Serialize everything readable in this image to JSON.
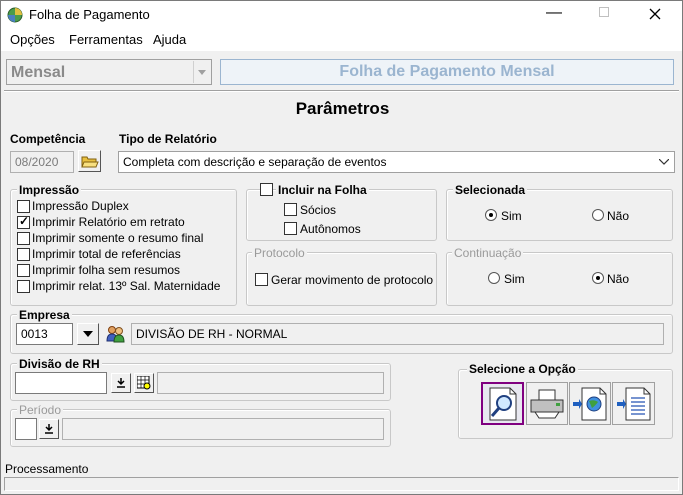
{
  "window": {
    "title": "Folha de Pagamento"
  },
  "menu": {
    "opcoes": "Opções",
    "ferramentas": "Ferramentas",
    "ajuda": "Ajuda"
  },
  "header": {
    "period_type": "Mensal",
    "banner": "Folha de Pagamento Mensal"
  },
  "params": {
    "title": "Parâmetros"
  },
  "competencia": {
    "label": "Competência",
    "value": "08/2020"
  },
  "tipo_relatorio": {
    "label": "Tipo de Relatório",
    "value": "Completa com descrição e separação de eventos"
  },
  "impressao": {
    "label": "Impressão",
    "items": [
      {
        "label": "Impressão Duplex",
        "checked": false
      },
      {
        "label": "Imprimir Relatório em retrato",
        "checked": true
      },
      {
        "label": "Imprimir somente o resumo final",
        "checked": false
      },
      {
        "label": "Imprimir total de referências",
        "checked": false
      },
      {
        "label": "Imprimir folha sem resumos",
        "checked": false
      },
      {
        "label": "Imprimir relat. 13º Sal. Maternidade",
        "checked": false
      }
    ]
  },
  "incluir": {
    "label": "Incluir na Folha",
    "socios": "Sócios",
    "autonomos": "Autônomos"
  },
  "protocolo": {
    "label": "Protocolo",
    "gerar": "Gerar movimento de protocolo"
  },
  "selecionada": {
    "label": "Selecionada",
    "sim": "Sim",
    "nao": "Não",
    "selected": "sim"
  },
  "continuacao": {
    "label": "Continuação",
    "sim": "Sim",
    "nao": "Não",
    "selected": "nao"
  },
  "empresa": {
    "label": "Empresa",
    "code": "0013",
    "name": "DIVISÃO DE RH - NORMAL"
  },
  "divisao": {
    "label": "Divisão de RH",
    "value": ""
  },
  "periodo": {
    "label": "Período"
  },
  "opcao": {
    "label": "Selecione a Opção"
  },
  "status": {
    "text": "Processamento"
  },
  "colors": {
    "banner_text": "#9bb5d0",
    "selected_border": "#800080"
  }
}
